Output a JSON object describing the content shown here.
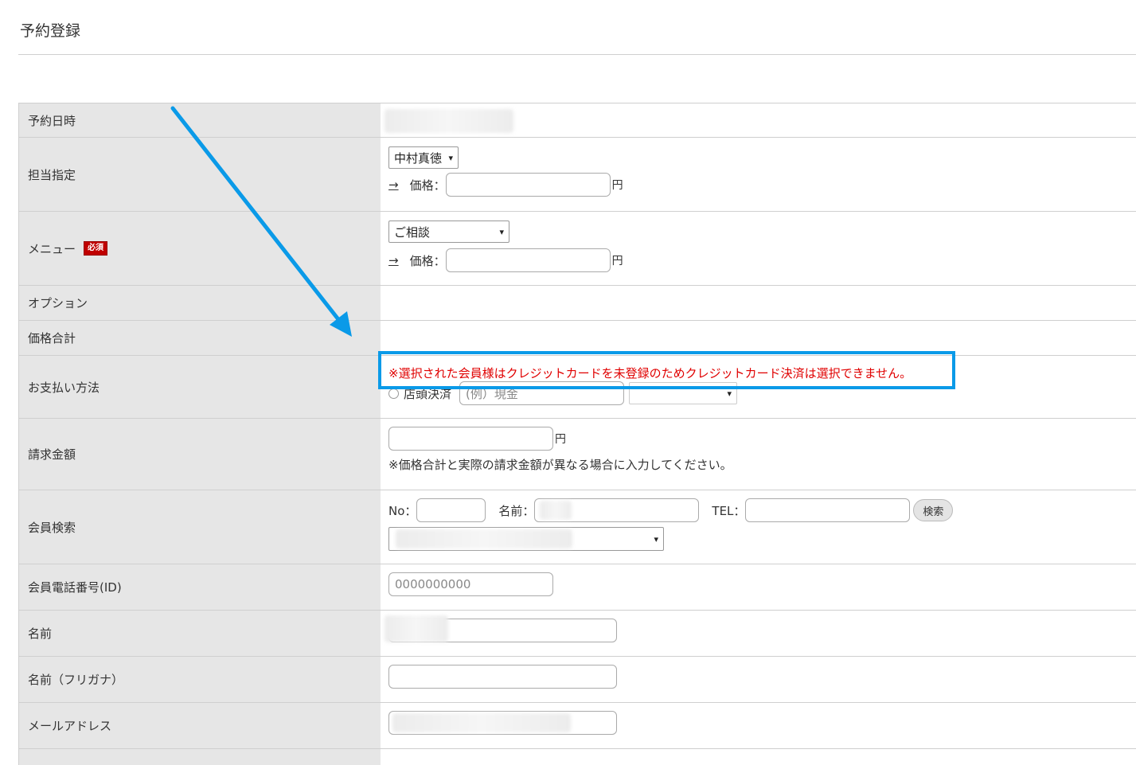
{
  "page": {
    "title": "予約登録"
  },
  "rows": {
    "datetime": {
      "label": "予約日時"
    },
    "staff": {
      "label": "担当指定",
      "selected": "中村真徳",
      "price_link": "→",
      "price_label": "価格：",
      "unit": "円"
    },
    "menu": {
      "label": "メニュー",
      "required_badge": "必須",
      "selected": "ご相談",
      "price_link": "→",
      "price_label": "価格：",
      "unit": "円"
    },
    "option": {
      "label": "オプション"
    },
    "total": {
      "label": "価格合計"
    },
    "payment": {
      "label": "お支払い方法",
      "notice": "※選択された会員様はクレジットカードを未登録のためクレジットカード決済は選択できません。",
      "store_label": "店頭決済",
      "store_placeholder": "(例）現金"
    },
    "billing": {
      "label": "請求金額",
      "unit": "円",
      "note": "※価格合計と実際の請求金額が異なる場合に入力してください。"
    },
    "member_search": {
      "label": "会員検索",
      "no_label": "No：",
      "name_label": "名前：",
      "tel_label": "TEL：",
      "search_button": "検索"
    },
    "phone": {
      "label": "会員電話番号(ID)",
      "placeholder": "0000000000"
    },
    "name": {
      "label": "名前"
    },
    "kana": {
      "label": "名前（フリガナ）"
    },
    "email": {
      "label": "メールアドレス"
    }
  },
  "colors": {
    "notice": "#e00000",
    "callout": "#0a9ae8",
    "label_bg": "#e6e6e6",
    "badge": "#c00000"
  },
  "icons": {
    "chevron": "chevron-down-icon",
    "radio": "radio-icon",
    "arrow": "annotation-arrow-icon"
  }
}
